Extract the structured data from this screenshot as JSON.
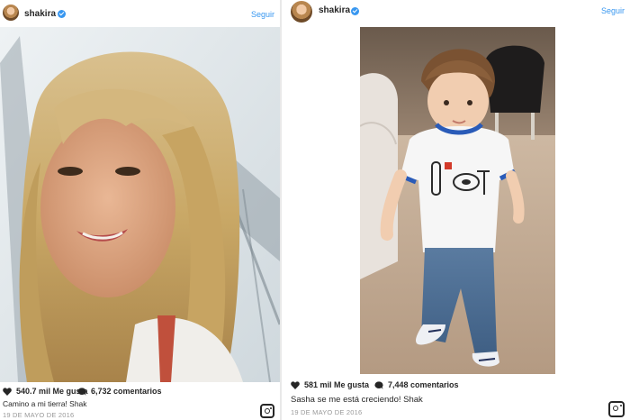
{
  "posts": [
    {
      "username": "shakira",
      "follow_label": "Seguir",
      "likes": "540.7 mil Me gusta",
      "comments": "6,732 comentarios",
      "caption": "Camino a mi tierra! Shak",
      "date": "19 DE MAYO DE 2016",
      "photo_alt": "selfie-blonde-woman"
    },
    {
      "username": "shakira",
      "follow_label": "Seguir",
      "likes": "581 mil Me gusta",
      "comments": "7,448 comentarios",
      "caption": "Sasha se me está creciendo! Shak",
      "date": "19 DE MAYO DE 2016",
      "photo_alt": "toddler-walking"
    }
  ],
  "colors": {
    "accent": "#3897f0",
    "text": "#262626",
    "muted": "#999999"
  },
  "icons": [
    "heart-icon",
    "comment-icon",
    "instagram-icon",
    "verified-badge-icon"
  ]
}
